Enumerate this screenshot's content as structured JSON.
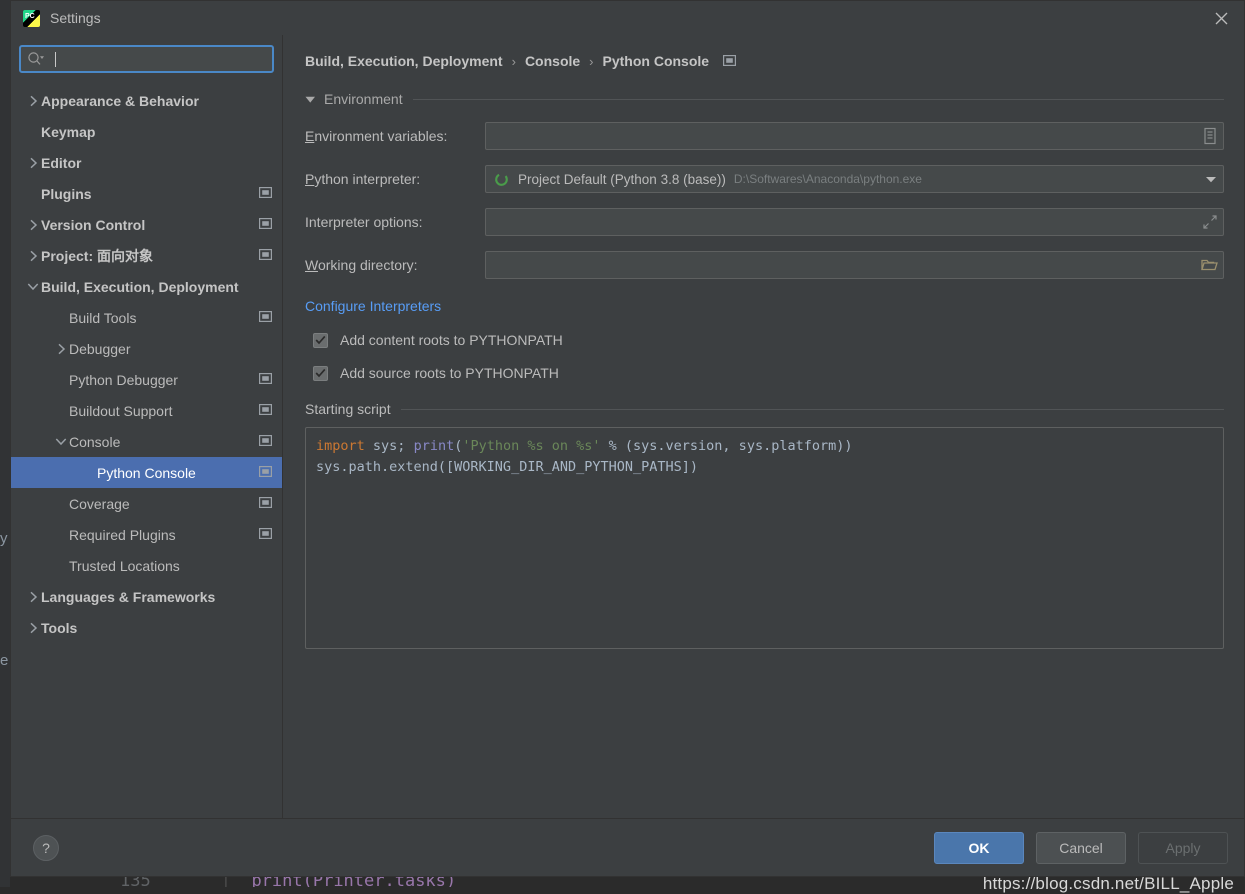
{
  "window": {
    "title": "Settings",
    "app_icon": "pycharm-icon",
    "close_icon": "close-icon"
  },
  "search": {
    "value": "",
    "placeholder": "",
    "icon": "search-icon"
  },
  "sidebar": {
    "items": [
      {
        "label": "Appearance & Behavior",
        "indent": 0,
        "arrow": "chevron-right",
        "bold": true,
        "scope_icon": false,
        "selected": false
      },
      {
        "label": "Keymap",
        "indent": 0,
        "arrow": "none",
        "bold": true,
        "scope_icon": false,
        "selected": false
      },
      {
        "label": "Editor",
        "indent": 0,
        "arrow": "chevron-right",
        "bold": true,
        "scope_icon": false,
        "selected": false
      },
      {
        "label": "Plugins",
        "indent": 0,
        "arrow": "none",
        "bold": true,
        "scope_icon": true,
        "selected": false
      },
      {
        "label": "Version Control",
        "indent": 0,
        "arrow": "chevron-right",
        "bold": true,
        "scope_icon": true,
        "selected": false
      },
      {
        "label": "Project: 面向对象",
        "indent": 0,
        "arrow": "chevron-right",
        "bold": true,
        "scope_icon": true,
        "selected": false
      },
      {
        "label": "Build, Execution, Deployment",
        "indent": 0,
        "arrow": "chevron-down",
        "bold": true,
        "scope_icon": false,
        "selected": false
      },
      {
        "label": "Build Tools",
        "indent": 1,
        "arrow": "none",
        "bold": false,
        "scope_icon": true,
        "selected": false
      },
      {
        "label": "Debugger",
        "indent": 1,
        "arrow": "chevron-right",
        "bold": false,
        "scope_icon": false,
        "selected": false
      },
      {
        "label": "Python Debugger",
        "indent": 1,
        "arrow": "none",
        "bold": false,
        "scope_icon": true,
        "selected": false
      },
      {
        "label": "Buildout Support",
        "indent": 1,
        "arrow": "none",
        "bold": false,
        "scope_icon": true,
        "selected": false
      },
      {
        "label": "Console",
        "indent": 1,
        "arrow": "chevron-down",
        "bold": false,
        "scope_icon": true,
        "selected": false
      },
      {
        "label": "Python Console",
        "indent": 2,
        "arrow": "none",
        "bold": false,
        "scope_icon": true,
        "selected": true
      },
      {
        "label": "Coverage",
        "indent": 1,
        "arrow": "none",
        "bold": false,
        "scope_icon": true,
        "selected": false
      },
      {
        "label": "Required Plugins",
        "indent": 1,
        "arrow": "none",
        "bold": false,
        "scope_icon": true,
        "selected": false
      },
      {
        "label": "Trusted Locations",
        "indent": 1,
        "arrow": "none",
        "bold": false,
        "scope_icon": false,
        "selected": false
      },
      {
        "label": "Languages & Frameworks",
        "indent": 0,
        "arrow": "chevron-right",
        "bold": true,
        "scope_icon": false,
        "selected": false
      },
      {
        "label": "Tools",
        "indent": 0,
        "arrow": "chevron-right",
        "bold": true,
        "scope_icon": false,
        "selected": false
      }
    ]
  },
  "breadcrumb": {
    "crumbs": [
      "Build, Execution, Deployment",
      "Console",
      "Python Console"
    ],
    "separator": "›",
    "scope_icon": "project-scope-icon"
  },
  "environment_section": {
    "title": "Environment",
    "collapse_icon": "triangle-down-icon",
    "env_variables": {
      "label": "Environment variables:",
      "mnemonic": "E",
      "value": "",
      "browse_icon": "list-edit-icon"
    },
    "python_interpreter": {
      "label": "Python interpreter:",
      "mnemonic": "P",
      "value": "Project Default (Python 3.8 (base))",
      "path": "D:\\Softwares\\Anaconda\\python.exe",
      "env_icon": "python-env-ring-icon",
      "dropdown_icon": "chevron-down-icon"
    },
    "interpreter_options": {
      "label": "Interpreter options:",
      "value": "",
      "expand_icon": "expand-arrows-icon"
    },
    "working_directory": {
      "label": "Working directory:",
      "mnemonic": "W",
      "value": "",
      "browse_icon": "folder-icon"
    },
    "configure_link": "Configure Interpreters",
    "checkboxes": [
      {
        "label": "Add content roots to PYTHONPATH",
        "checked": true
      },
      {
        "label": "Add source roots to PYTHONPATH",
        "checked": true
      }
    ]
  },
  "starting_script": {
    "title": "Starting script",
    "lines": [
      {
        "tokens": [
          {
            "text": "import",
            "type": "keyword"
          },
          {
            "text": " sys; ",
            "type": "plain"
          },
          {
            "text": "print",
            "type": "function"
          },
          {
            "text": "(",
            "type": "plain"
          },
          {
            "text": "'Python %s on %s'",
            "type": "string"
          },
          {
            "text": " % (sys.version, sys.platform))",
            "type": "plain"
          }
        ]
      },
      {
        "tokens": [
          {
            "text": "sys.path.extend([WORKING_DIR_AND_PYTHON_PATHS])",
            "type": "plain"
          }
        ]
      }
    ]
  },
  "footer": {
    "help_label": "?",
    "buttons": [
      {
        "label": "OK",
        "style": "primary",
        "enabled": true
      },
      {
        "label": "Cancel",
        "style": "normal",
        "enabled": true
      },
      {
        "label": "Apply",
        "style": "disabled",
        "enabled": false
      }
    ]
  },
  "watermark": "https://blog.csdn.net/BILL_Apple",
  "background": {
    "fragment_left_upper": "y",
    "fragment_left_lower": "e",
    "code_line_number": "135",
    "code_text": "print(Printer.tasks)"
  },
  "colors": {
    "dialog_bg": "#3c3f41",
    "field_bg": "#45494a",
    "selection_blue": "#4b6eaf",
    "link_blue": "#589df6",
    "primary_button": "#4a76ab",
    "keyword_orange": "#cc7832",
    "function_purple": "#8888c6",
    "string_green": "#6a8759",
    "text_default": "#bbbbbb"
  }
}
